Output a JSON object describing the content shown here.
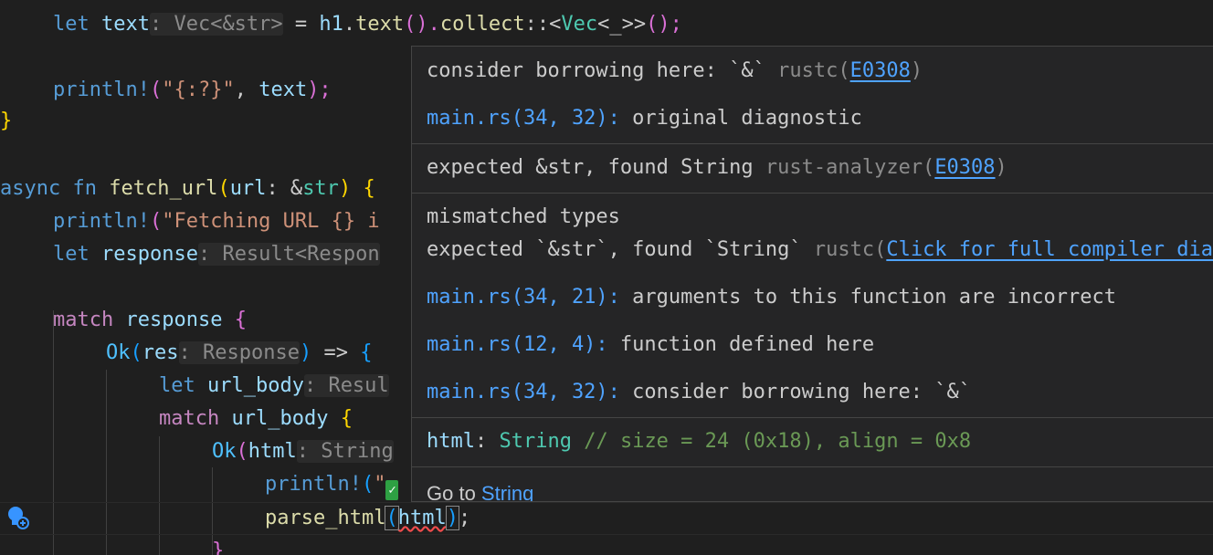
{
  "editor": {
    "lines": [
      {
        "id": "l0",
        "prefix": "let ",
        "name": "text",
        "hint": ": Vec<&str>",
        "rest1": " = ",
        "obj": "h1",
        "dot": ".",
        "m1": "text",
        "p1": "().",
        "m2": "collect",
        "turbofish": "::<",
        "vec": "Vec",
        "gen": "<_>>",
        "tail": "();"
      },
      {
        "id": "l1",
        "mac": "println!",
        "open": "(",
        "str": "\"{:?}\"",
        "comma": ", ",
        "arg": "text",
        "close": ");"
      },
      {
        "id": "l2",
        "brace": "}"
      },
      {
        "id": "l3",
        "async": "async",
        "fn": " fn ",
        "name": "fetch_url",
        "open": "(",
        "param": "url",
        "colon": ": &",
        "ty": "str",
        "close": ") ",
        "brace": "{"
      },
      {
        "id": "l4",
        "mac": "println!",
        "open": "(",
        "str": "\"Fetching URL {} i"
      },
      {
        "id": "l5",
        "kw": "let ",
        "name": "response",
        "hint": ": Result<Respon"
      },
      {
        "id": "l6",
        "kw": "match ",
        "name": "response",
        "brace": " {"
      },
      {
        "id": "l7",
        "ok": "Ok",
        "open": "(",
        "name": "res",
        "hint": ": Response",
        "close": ")",
        "arrow": " => ",
        "brace": "{"
      },
      {
        "id": "l8",
        "kw": "let ",
        "name": "url_body",
        "hint": ": Resul"
      },
      {
        "id": "l9",
        "kw": "match ",
        "name": "url_body",
        "brace": " {"
      },
      {
        "id": "l10",
        "ok": "Ok",
        "open": "(",
        "name": "html",
        "hint": ": String"
      },
      {
        "id": "l11",
        "mac": "println!",
        "open": "(",
        "str": "\""
      },
      {
        "id": "l12",
        "fn": "parse_html",
        "open": "(",
        "arg": "html",
        "close": ")",
        "semi": ";"
      },
      {
        "id": "l13",
        "brace": "}"
      }
    ]
  },
  "hover": {
    "d1_text": "consider borrowing here: `&` ",
    "d1_src": "rustc(",
    "d1_code": "E0308",
    "d1_end": ")",
    "d2_loc": "main.rs(34, 32):",
    "d2_text": " original diagnostic",
    "d3_text": "expected &str, found String ",
    "d3_src": "rust-analyzer(",
    "d3_code": "E0308",
    "d3_end": ")",
    "d4_title": "mismatched types",
    "d4_text": "expected `&str`, found `String` ",
    "d4_src": "rustc(",
    "d4_link": "Click for full compiler diagnostic",
    "d5_loc": "main.rs(34, 21):",
    "d5_text": " arguments to this function are incorrect",
    "d6_loc": "main.rs(12, 4):",
    "d6_text": " function defined here",
    "d7_loc": "main.rs(34, 32):",
    "d7_text": " consider borrowing here: `&`",
    "sig_name": "html",
    "sig_colon": ": ",
    "sig_type": "String",
    "sig_comment": " // size = 24 (0x18), align = 0x8",
    "goto_prefix": "Go to ",
    "goto_link": "String"
  },
  "colors": {
    "background": "#1f1f1f",
    "hover_background": "#252526",
    "link": "#4fa3ff",
    "error_squiggle": "#f14c4c"
  }
}
